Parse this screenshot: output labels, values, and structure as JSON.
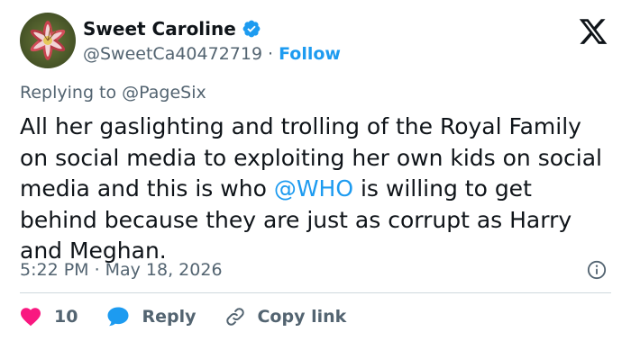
{
  "author": {
    "display_name": "Sweet Caroline",
    "handle": "@SweetCa40472719",
    "separator": "·",
    "follow_label": "Follow",
    "avatar_icon": "lily-flower-photo",
    "verified_icon": "verified-badge-icon",
    "verified_color": "#1d9bf0"
  },
  "brand_icon": "x-logo-icon",
  "reply_context": {
    "prefix": "Replying to",
    "mention": "@PageSix"
  },
  "tweet": {
    "text_before_mention": "All her gaslighting and trolling of the Royal Family on social media to exploiting her own kids on social media and this is who ",
    "mention": "@WHO",
    "text_after_mention": " is willing to get behind because they are just as corrupt as Harry and Meghan."
  },
  "meta": {
    "time": "5:22 PM",
    "separator": "·",
    "date": "May 18, 2026",
    "info_icon": "info-icon"
  },
  "actions": {
    "like_count": "10",
    "like_icon": "heart-icon",
    "like_color": "#f91880",
    "reply_label": "Reply",
    "reply_icon": "speech-bubble-icon",
    "reply_color": "#1d9bf0",
    "copy_label": "Copy link",
    "copy_icon": "link-icon"
  },
  "colors": {
    "text": "#0f1419",
    "secondary": "#536471",
    "accent": "#1d9bf0",
    "divider": "#cfd9de"
  }
}
